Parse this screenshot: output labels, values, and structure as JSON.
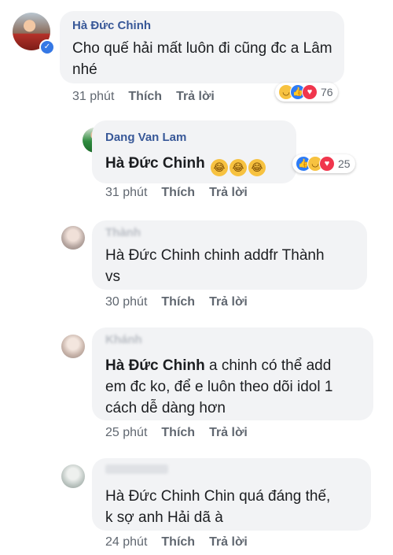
{
  "comments": [
    {
      "author": "Hà Đức Chinh",
      "text": "Cho quế hải mất luôn đi cũng đc a Lâm nhé",
      "time": "31 phút",
      "like": "Thích",
      "reply": "Trả lời",
      "reactions": {
        "icons": [
          "haha-icon",
          "like-icon",
          "love-icon"
        ],
        "count": "76"
      }
    },
    {
      "author": "Dang Van Lam",
      "mention": "Hà Đức Chinh",
      "time": "31 phút",
      "like": "Thích",
      "reply": "Trả lời",
      "reactions": {
        "icons": [
          "like-icon",
          "haha-icon",
          "love-icon"
        ],
        "count": "25"
      }
    },
    {
      "author": "Thành",
      "mention": "Hà Đức Chinh",
      "text_line1": "chinh addfr Thành",
      "text_line2": "vs",
      "time": "30 phút",
      "like": "Thích",
      "reply": "Trả lời"
    },
    {
      "author": "Khánh",
      "mention": "Hà Đức Chinh",
      "text_line1": "a chinh có thể add",
      "text_line2": "em đc ko, để e luôn theo dõi idol 1",
      "text_line3": "cách dễ dàng hơn",
      "time": "25 phút",
      "like": "Thích",
      "reply": "Trả lời"
    },
    {
      "mention": "Hà Đức Chinh",
      "text_line1": "Chin quá đáng thế,",
      "text_line2": "k sợ anh Hải dã à",
      "time": "24 phút",
      "like": "Thích",
      "reply": "Trả lời"
    }
  ],
  "colors": {
    "bubble": "#f2f3f5",
    "name": "#385898",
    "meta": "#606770",
    "like": "#2e7cf6",
    "love": "#f0364d",
    "haha": "#f7c240"
  }
}
